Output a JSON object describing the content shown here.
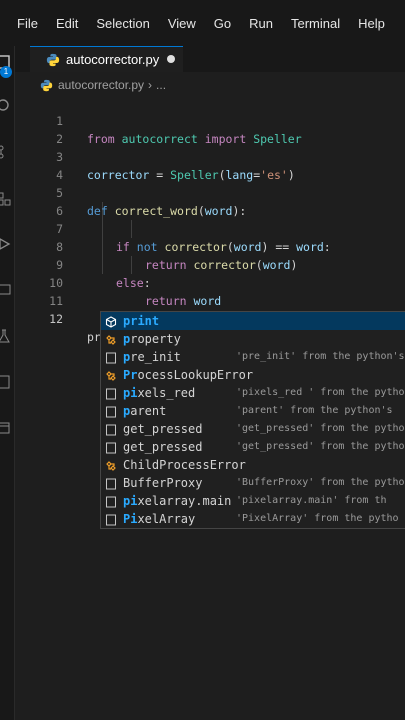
{
  "menu": [
    "File",
    "Edit",
    "Selection",
    "View",
    "Go",
    "Run",
    "Terminal",
    "Help"
  ],
  "tab": {
    "filename": "autocorrector.py"
  },
  "breadcrumb": {
    "file": "autocorrector.py",
    "rest": "..."
  },
  "activity": {
    "badge": "1"
  },
  "editor": {
    "line_numbers": [
      "1",
      "2",
      "3",
      "4",
      "5",
      "6",
      "7",
      "8",
      "9",
      "10",
      "11",
      "12"
    ],
    "active_line": "12",
    "lines": {
      "l1": [
        "from",
        " autocorrect ",
        "import",
        " Speller"
      ],
      "l3": [
        "corrector",
        " = ",
        "Speller",
        "(",
        "lang",
        "=",
        "'es'",
        ")"
      ],
      "l5": [
        "def",
        " ",
        "correct_word",
        "(",
        "word",
        "):"
      ],
      "l7": [
        "if",
        " ",
        "not",
        " ",
        "corrector",
        "(",
        "word",
        ") == ",
        "word",
        ":"
      ],
      "l8": [
        "return",
        " ",
        "corrector",
        "(",
        "word",
        ")"
      ],
      "l9": [
        "else",
        ":"
      ],
      "l10": [
        "return",
        " ",
        "word"
      ],
      "l12": [
        "print"
      ]
    }
  },
  "suggestions": [
    {
      "label_match": "print",
      "label_rest": "",
      "icon": "cube-icon",
      "detail": ""
    },
    {
      "label_match": "p",
      "label_rest": "roperty",
      "icon": "class-icon",
      "detail": ""
    },
    {
      "label_match": "p",
      "label_rest": "re_init",
      "icon": "text-icon",
      "detail": "'pre_init' from the python's"
    },
    {
      "label_match": "Pr",
      "label_rest": "ocessLookupError",
      "icon": "class-icon",
      "detail": ""
    },
    {
      "label_match": "pi",
      "label_rest": "xels_red",
      "icon": "text-icon",
      "detail": "'pixels_red ' from the pytho"
    },
    {
      "label_match": "p",
      "label_rest": "arent",
      "icon": "text-icon",
      "detail": "'parent' from the python's"
    },
    {
      "label_match": "",
      "label_rest": "get_pressed",
      "icon": "text-icon",
      "detail": "'get_pressed' from the pytho"
    },
    {
      "label_match": "",
      "label_rest": "get_pressed",
      "icon": "text-icon",
      "detail": "'get_pressed' from the pytho"
    },
    {
      "label_match": "",
      "label_rest": "ChildProcessError",
      "icon": "class-icon",
      "detail": ""
    },
    {
      "label_match": "",
      "label_rest": "BufferProxy",
      "icon": "text-icon",
      "detail": "'BufferProxy' from the pytho"
    },
    {
      "label_match": "pi",
      "label_rest": "xelarray.main",
      "icon": "text-icon",
      "detail": "'pixelarray.main' from th"
    },
    {
      "label_match": "Pi",
      "label_rest": "xelArray",
      "icon": "text-icon",
      "detail": "'PixelArray' from the pytho"
    }
  ]
}
